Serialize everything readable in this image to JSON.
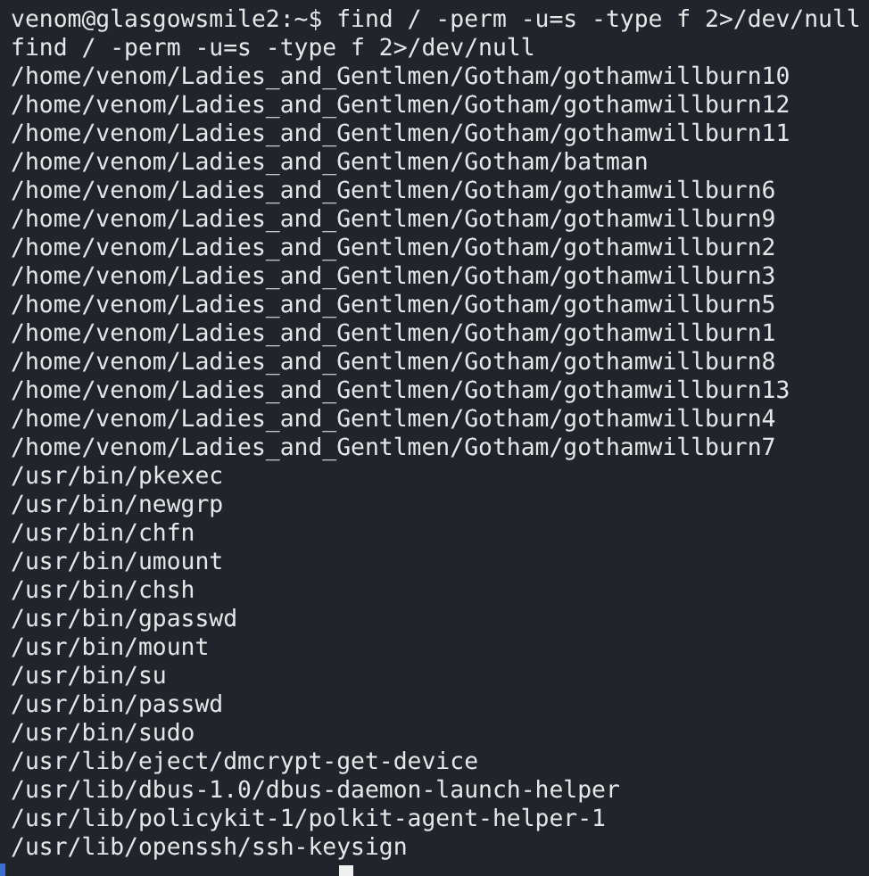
{
  "terminal": {
    "lines": [
      "venom@glasgowsmile2:~$ find / -perm -u=s -type f 2>/dev/null",
      "find / -perm -u=s -type f 2>/dev/null",
      "/home/venom/Ladies_and_Gentlmen/Gotham/gothamwillburn10",
      "/home/venom/Ladies_and_Gentlmen/Gotham/gothamwillburn12",
      "/home/venom/Ladies_and_Gentlmen/Gotham/gothamwillburn11",
      "/home/venom/Ladies_and_Gentlmen/Gotham/batman",
      "/home/venom/Ladies_and_Gentlmen/Gotham/gothamwillburn6",
      "/home/venom/Ladies_and_Gentlmen/Gotham/gothamwillburn9",
      "/home/venom/Ladies_and_Gentlmen/Gotham/gothamwillburn2",
      "/home/venom/Ladies_and_Gentlmen/Gotham/gothamwillburn3",
      "/home/venom/Ladies_and_Gentlmen/Gotham/gothamwillburn5",
      "/home/venom/Ladies_and_Gentlmen/Gotham/gothamwillburn1",
      "/home/venom/Ladies_and_Gentlmen/Gotham/gothamwillburn8",
      "/home/venom/Ladies_and_Gentlmen/Gotham/gothamwillburn13",
      "/home/venom/Ladies_and_Gentlmen/Gotham/gothamwillburn4",
      "/home/venom/Ladies_and_Gentlmen/Gotham/gothamwillburn7",
      "/usr/bin/pkexec",
      "/usr/bin/newgrp",
      "/usr/bin/chfn",
      "/usr/bin/umount",
      "/usr/bin/chsh",
      "/usr/bin/gpasswd",
      "/usr/bin/mount",
      "/usr/bin/su",
      "/usr/bin/passwd",
      "/usr/bin/sudo",
      "/usr/lib/eject/dmcrypt-get-device",
      "/usr/lib/dbus-1.0/dbus-daemon-launch-helper",
      "/usr/lib/policykit-1/polkit-agent-helper-1",
      "/usr/lib/openssh/ssh-keysign"
    ]
  }
}
